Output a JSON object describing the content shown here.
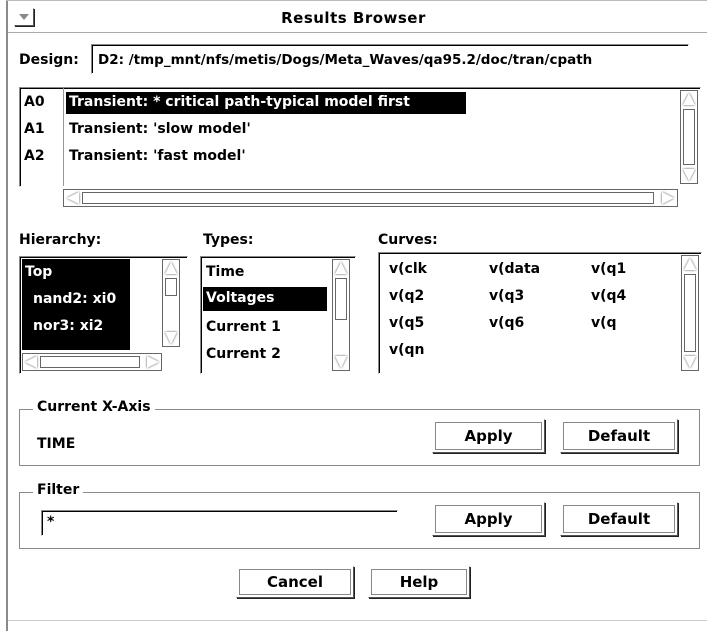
{
  "window": {
    "title": "Results Browser"
  },
  "design": {
    "label": "Design:",
    "value": "D2: /tmp_mnt/nfs/metis/Dogs/Meta_Waves/qa95.2/doc/tran/cpath"
  },
  "results": {
    "ids": [
      "A0",
      "A1",
      "A2"
    ],
    "rows": [
      "Transient: * critical path-typical model first",
      "Transient: 'slow model'",
      "Transient: 'fast model'"
    ],
    "selected_index": 0
  },
  "hierarchy": {
    "label": "Hierarchy:",
    "items": [
      "Top",
      "nand2: xi0",
      "nor3: xi2"
    ]
  },
  "types": {
    "label": "Types:",
    "items": [
      "Time",
      "Voltages",
      "Current 1",
      "Current 2"
    ],
    "selected_index": 1
  },
  "curves": {
    "label": "Curves:",
    "items": [
      "v(clk",
      "v(data",
      "v(q1",
      "v(q2",
      "v(q3",
      "v(q4",
      "v(q5",
      "v(q6",
      "v(q",
      "v(qn"
    ]
  },
  "xaxis": {
    "title": "Current X-Axis",
    "value": "TIME",
    "apply_label": "Apply",
    "default_label": "Default"
  },
  "filter": {
    "title": "Filter",
    "value": "*",
    "apply_label": "Apply",
    "default_label": "Default"
  },
  "footer": {
    "cancel_label": "Cancel",
    "help_label": "Help"
  },
  "icons": {
    "window_menu": "window-menu-icon",
    "scroll_up": "arrow-up-icon",
    "scroll_down": "arrow-down-icon",
    "scroll_left": "arrow-left-icon",
    "scroll_right": "arrow-right-icon"
  }
}
